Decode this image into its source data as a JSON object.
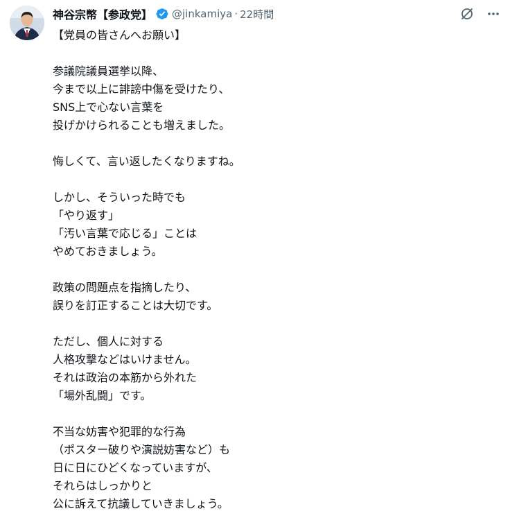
{
  "author": {
    "display_name": "神谷宗幣【参政党】",
    "handle": "@jinkamiya",
    "separator": "·",
    "time": "22時間",
    "verified_color": "#1d9bf0"
  },
  "icons": {
    "avatar": "profile-avatar",
    "verified": "verified-badge-icon",
    "grok": "grok-icon",
    "more": "more-icon"
  },
  "post": {
    "paragraphs": [
      [
        "【党員の皆さんへお願い】"
      ],
      [
        "参議院議員選挙以降、",
        "今まで以上に誹謗中傷を受けたり、",
        "SNS上で心ない言葉を",
        "投げかけられることも増えました。"
      ],
      [
        "悔しくて、言い返したくなりますね。"
      ],
      [
        "しかし、そういった時でも",
        "「やり返す」",
        "「汚い言葉で応じる」ことは",
        "やめておきましょう。"
      ],
      [
        "政策の問題点を指摘したり、",
        "誤りを訂正することは大切です。"
      ],
      [
        "ただし、個人に対する",
        "人格攻撃などはいけません。",
        "それは政治の本筋から外れた",
        "「場外乱闘」です。"
      ],
      [
        "不当な妨害や犯罪的な行為",
        "（ポスター破りや演説妨害など）も",
        "日に日にひどくなっていますが、",
        "それらはしっかりと",
        "公に訴えて抗議していきましょう。"
      ]
    ]
  }
}
